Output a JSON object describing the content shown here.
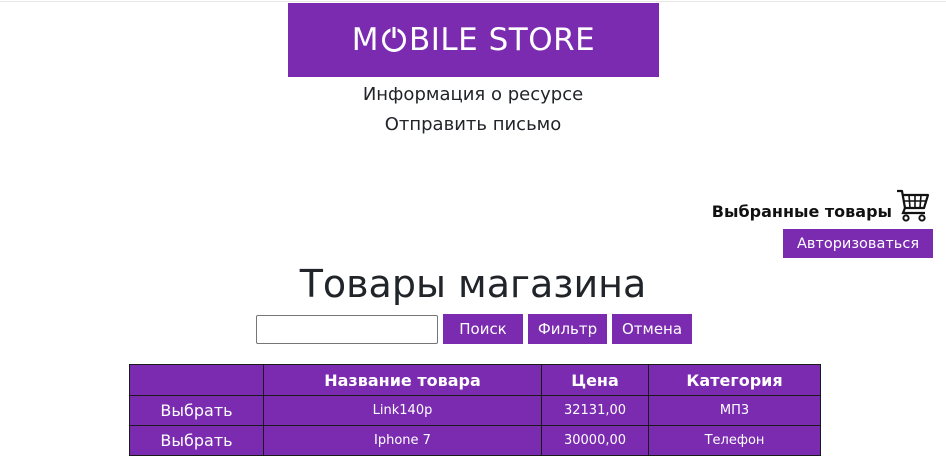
{
  "header": {
    "logo_prefix": "M",
    "logo_suffix": "BILE STORE",
    "logo_icon": "power-icon"
  },
  "nav": {
    "info_link": "Информация о ресурсе",
    "mail_link": "Отправить письмо"
  },
  "cart": {
    "label": "Выбранные товары",
    "icon": "cart-icon"
  },
  "auth": {
    "button_label": "Авторизоваться"
  },
  "main": {
    "title": "Товары магазина"
  },
  "search": {
    "value": "",
    "placeholder": "",
    "search_button": "Поиск",
    "filter_button": "Фильтр",
    "cancel_button": "Отмена"
  },
  "table": {
    "headers": [
      "",
      "Название товара",
      "Цена",
      "Категория"
    ],
    "rows": [
      {
        "action": "Выбрать",
        "name": "Link140p",
        "price": "32131,00",
        "category": "МП3"
      },
      {
        "action": "Выбрать",
        "name": "Iphone 7",
        "price": "30000,00",
        "category": "Телефон"
      }
    ]
  },
  "colors": {
    "brand_purple": "#7a2bb0",
    "text_dark": "#212529",
    "white": "#ffffff"
  }
}
